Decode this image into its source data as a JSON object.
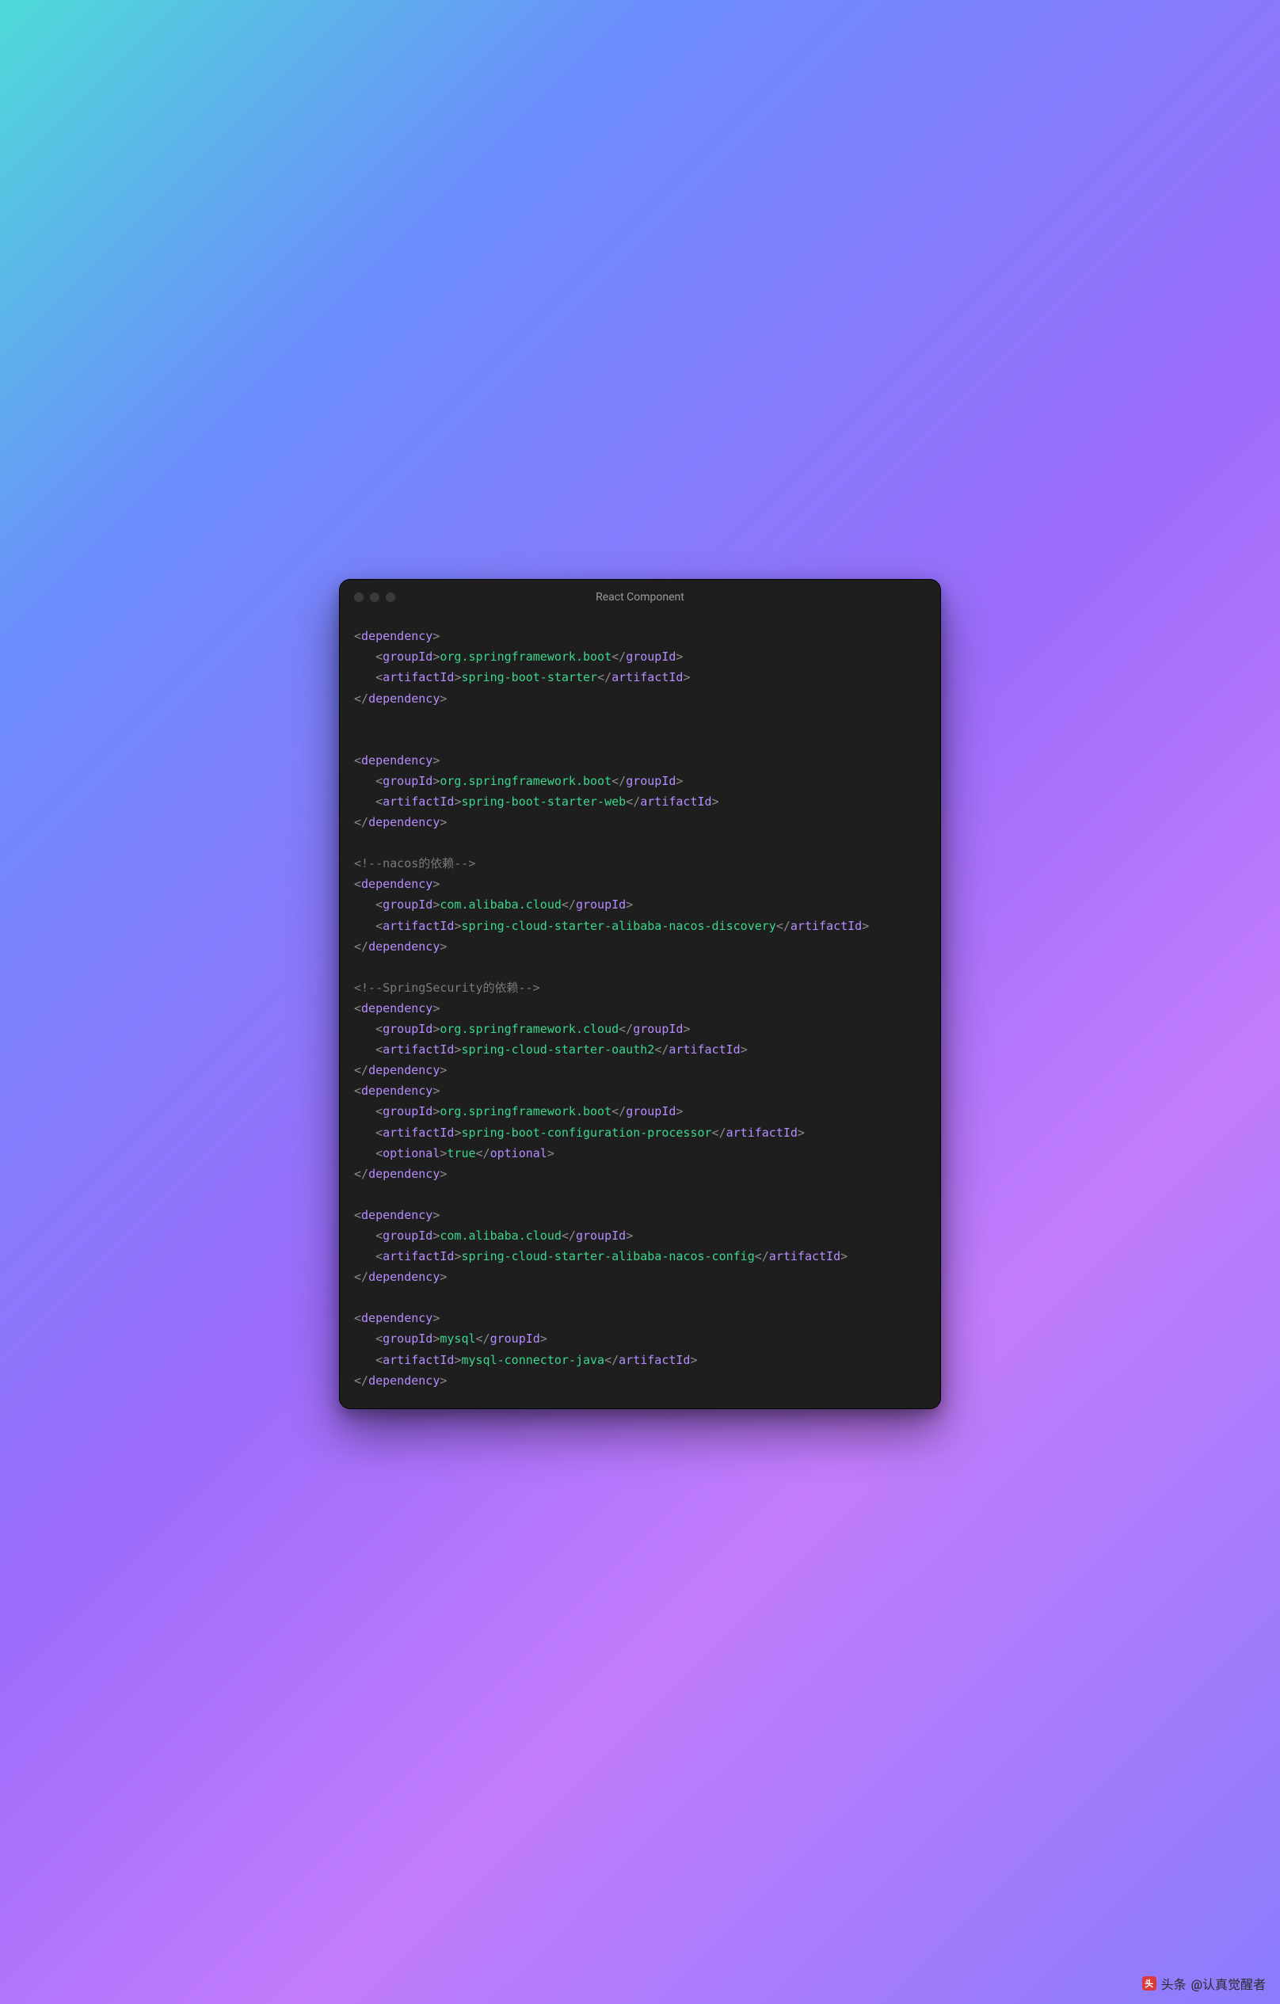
{
  "window": {
    "title": "React Component"
  },
  "footer": {
    "brand": "头条",
    "handle": "@认真觉醒者",
    "logo_glyph": "头"
  },
  "code": {
    "indent": "   ",
    "deps": [
      {
        "groupId": "org.springframework.boot",
        "artifactId": "spring-boot-starter",
        "blank_after": 2
      },
      {
        "groupId": "org.springframework.boot",
        "artifactId": "spring-boot-starter-web",
        "blank_after": 1
      },
      {
        "comment_before": "<!--nacos的依赖-->",
        "groupId": "com.alibaba.cloud",
        "artifactId": "spring-cloud-starter-alibaba-nacos-discovery",
        "blank_after": 1
      },
      {
        "comment_before": "<!--SpringSecurity的依赖-->",
        "groupId": "org.springframework.cloud",
        "artifactId": "spring-cloud-starter-oauth2",
        "blank_after": 0
      },
      {
        "groupId": "org.springframework.boot",
        "artifactId": "spring-boot-configuration-processor",
        "optional": "true",
        "blank_after": 1
      },
      {
        "groupId": "com.alibaba.cloud",
        "artifactId": "spring-cloud-starter-alibaba-nacos-config",
        "blank_after": 1
      },
      {
        "groupId": "mysql",
        "artifactId": "mysql-connector-java",
        "blank_after": 0
      }
    ]
  }
}
